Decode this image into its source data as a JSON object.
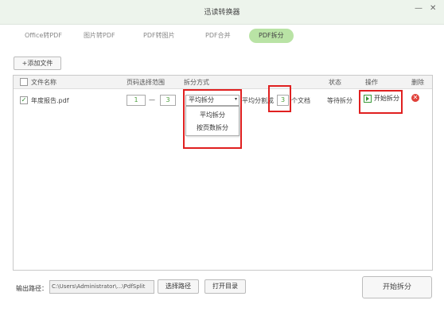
{
  "window": {
    "title": "迅读转换器",
    "minimize_icon": "minimize-icon",
    "close_icon": "close-icon",
    "close_glyph": "✕",
    "minimize_glyph": "—"
  },
  "tabs": [
    {
      "label": "Office转PDF"
    },
    {
      "label": "图片转PDF"
    },
    {
      "label": "PDF转图片"
    },
    {
      "label": "PDF合并"
    },
    {
      "label": "PDF拆分",
      "active": true
    }
  ],
  "toolbar": {
    "add_file_label": "+添加文件"
  },
  "table": {
    "columns": {
      "filename": "文件名称",
      "page_range": "页码选择范围",
      "split_mode": "拆分方式",
      "status": "状态",
      "action": "操作",
      "delete": "删除"
    },
    "rows": [
      {
        "checked": true,
        "check_glyph": "✓",
        "filename": "年度报告.pdf",
        "page_from": "1",
        "page_sep": "—",
        "page_to": "3",
        "split_mode": "平均拆分",
        "split_prefix": "平均分割成",
        "split_count": "3",
        "split_suffix": "个文档",
        "status": "等待拆分",
        "action_label": "开始拆分",
        "delete_glyph": "✕"
      }
    ]
  },
  "dropdown": {
    "arrow_glyph": "▾",
    "options": [
      {
        "label": "平均拆分"
      },
      {
        "label": "按页数拆分"
      }
    ]
  },
  "footer": {
    "output_label": "输出路径：",
    "output_path": "C:\\Users\\Administrator\\...\\PdfSplit",
    "choose_path_label": "选择路径",
    "open_dir_label": "打开目录",
    "start_label": "开始拆分"
  },
  "colors": {
    "accent_green": "#b9e3a5",
    "titlebar_bg": "#edf4ec",
    "highlight_red": "#e02020",
    "delete_red": "#e0413a"
  }
}
